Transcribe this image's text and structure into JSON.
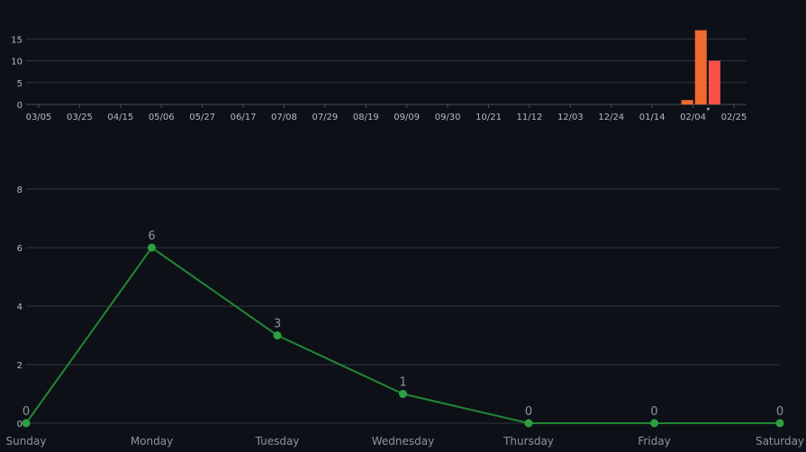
{
  "chart_data": [
    {
      "type": "bar",
      "title": "",
      "xlabel": "",
      "ylabel": "",
      "ylim": [
        0,
        20
      ],
      "yticks": [
        0,
        5,
        10,
        15
      ],
      "x_tick_labels": [
        "03/05",
        "03/25",
        "04/15",
        "05/06",
        "05/27",
        "06/17",
        "07/08",
        "07/29",
        "08/19",
        "09/09",
        "09/30",
        "10/21",
        "11/12",
        "12/03",
        "12/24",
        "01/14",
        "02/04",
        "02/25"
      ],
      "grid": true,
      "series": [
        {
          "color": "#f06a2e",
          "points": [
            {
              "x": "02/01",
              "value": 1
            },
            {
              "x": "02/08",
              "value": 17
            }
          ]
        },
        {
          "color": "#f85149",
          "points": [
            {
              "x": "02/15",
              "value": 10
            }
          ]
        }
      ],
      "marker_color": "#8b949e"
    },
    {
      "type": "line",
      "title": "",
      "xlabel": "",
      "ylabel": "",
      "categories": [
        "Sunday",
        "Monday",
        "Tuesday",
        "Wednesday",
        "Thursday",
        "Friday",
        "Saturday"
      ],
      "values": [
        0,
        6,
        3,
        1,
        0,
        0,
        0
      ],
      "ylim": [
        0,
        8
      ],
      "yticks": [
        0,
        2,
        4,
        6,
        8
      ],
      "grid": true,
      "color": "#238636",
      "point_color": "#2ea043"
    }
  ]
}
